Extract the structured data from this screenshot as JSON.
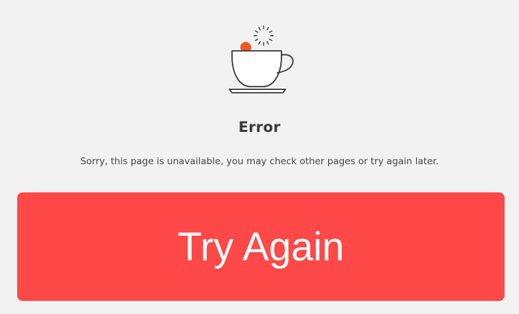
{
  "error_page": {
    "icon": "coffee-cup-icon",
    "title": "Error",
    "message": "Sorry, this page is unavailable, you may check other pages or try again later.",
    "retry_button_label": "Try Again"
  },
  "colors": {
    "background": "#f2f2f2",
    "button": "#ff4848",
    "button_text": "#ffffff",
    "accent_dot": "#f05a22",
    "icon_stroke": "#333333"
  }
}
